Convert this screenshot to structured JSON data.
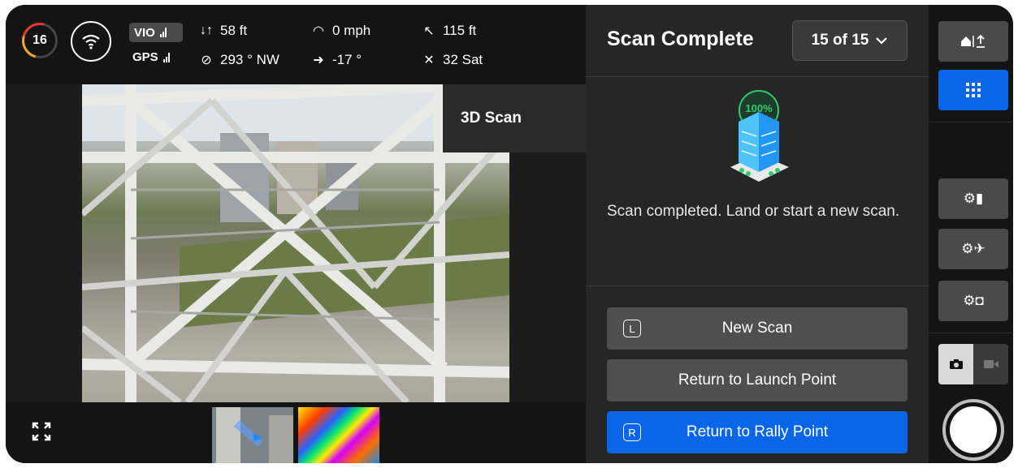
{
  "status": {
    "battery": "16",
    "vio_label": "VIO",
    "gps_label": "GPS",
    "altitude": "58 ft",
    "heading": "293 ° NW",
    "speed": "0 mph",
    "gimbal_pitch": "-17 °",
    "distance": "115 ft",
    "satellites": "32 Sat"
  },
  "camera": {
    "mode_label": "3D Scan"
  },
  "panel": {
    "title": "Scan Complete",
    "progress_selector": "15 of 15",
    "badge_percent": "100%",
    "message": "Scan completed. Land or start a new scan.",
    "buttons": [
      {
        "label": "New Scan",
        "key": "L"
      },
      {
        "label": "Return to Launch Point",
        "key": ""
      },
      {
        "label": "Return to Rally Point",
        "key": "R"
      }
    ]
  },
  "colors": {
    "accent_blue": "#0a66e8",
    "panel_bg": "#262626",
    "button_gray": "#4f4f4f"
  },
  "icons": {
    "battery": "battery-ring-icon",
    "wifi": "wifi-icon",
    "altitude": "altitude-arrows-icon",
    "heading": "compass-icon",
    "speed": "speedometer-icon",
    "gimbal": "gimbal-icon",
    "distance": "distance-icon",
    "satellite": "satellite-icon",
    "expand": "expand-icon",
    "home": "home-altitude-icon",
    "grid": "grid-icon",
    "settings_map": "settings-map-icon",
    "settings_drone": "settings-drone-icon",
    "settings_camera": "settings-camera-icon",
    "photo": "photo-camera-icon",
    "video": "video-camera-icon"
  }
}
